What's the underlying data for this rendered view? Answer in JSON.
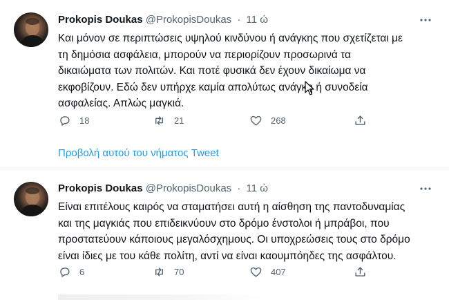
{
  "tweets": [
    {
      "name": "Prokopis Doukas",
      "handle": "@ProkopisDoukas",
      "separator": "·",
      "time": "11 ώ",
      "lines": [
        "Και μόνον σε περιπτώσεις υψηλού κινδύνου ή ανάγκης που σχετίζεται με",
        "τη δημόσια ασφάλεια, μπορούν να περιορίζουν προσωρινά τα",
        "δικαιώματα των πολιτών. Και ποτέ φυσικά δεν έχουν δικαίωμα να",
        "εκφοβίζουν. Εδώ δεν υπήρχε καμία απολύτως ανάγκη ή συνοδεία",
        "ασφαλείας. Απλώς μαγκιά."
      ],
      "replies": "18",
      "retweets": "21",
      "likes": "268",
      "more_icon": "more-horizontal-icon"
    },
    {
      "name": "Prokopis Doukas",
      "handle": "@ProkopisDoukas",
      "separator": "·",
      "time": "11 ώ",
      "lines": [
        "Είναι επιτέλους καιρός να σταματήσει αυτή η αίσθηση της παντοδυναμίας",
        "και της μαγκιάς που επιδεικνύουν στο δρόμο ένστολοι ή μπράβοι, που",
        "προστατεύουν κάποιους μεγαλόσχημους. Οι υποχρεώσεις τους στο δρόμο",
        "είναι ίδιες με του κάθε πολίτη, αντί να είναι καουμπόηδες της ασφάλτου."
      ],
      "replies": "6",
      "retweets": "70",
      "likes": "407",
      "more_icon": "more-horizontal-icon"
    }
  ],
  "thread_link": "Προβολή αυτού του νήματος Tweet",
  "icons": {
    "reply": "reply-icon",
    "retweet": "retweet-icon",
    "like": "heart-icon",
    "share": "share-icon"
  },
  "colors": {
    "link": "#1d9bf0",
    "muted": "#536471",
    "text": "#0f1419",
    "divider": "#eff3f4"
  }
}
